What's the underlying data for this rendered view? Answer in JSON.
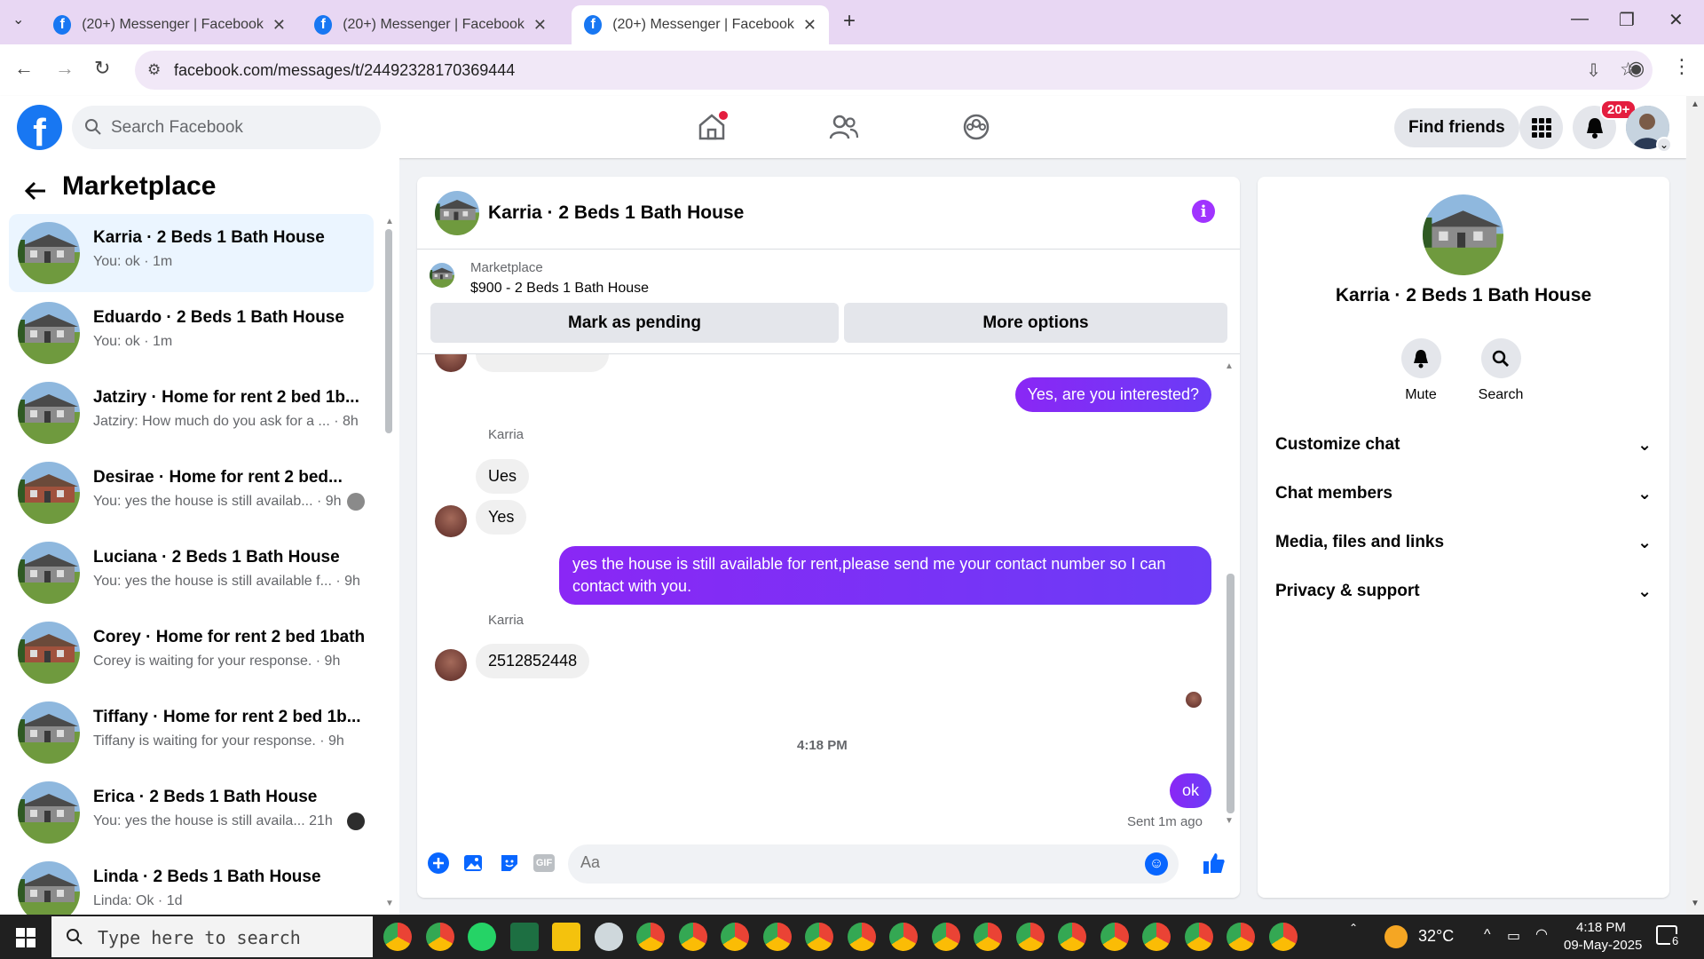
{
  "browser": {
    "tabs": [
      {
        "title": "(20+) Messenger | Facebook",
        "active": false
      },
      {
        "title": "(20+) Messenger | Facebook",
        "active": false
      },
      {
        "title": "(20+) Messenger | Facebook",
        "active": true
      }
    ],
    "url": "facebook.com/messages/t/24492328170369444"
  },
  "fb": {
    "search_placeholder": "Search Facebook",
    "find_friends": "Find friends",
    "notif_count": "20+"
  },
  "sidebar": {
    "title": "Marketplace",
    "conversations": [
      {
        "name": "Karria · 2 Beds 1 Bath House",
        "preview": "You: ok · 1m",
        "selected": true
      },
      {
        "name": "Eduardo · 2 Beds 1 Bath House",
        "preview": "You: ok · 1m"
      },
      {
        "name": "Jatziry · Home for rent 2 bed 1b...",
        "preview": "Jatziry: How much do you ask for a ... · 8h"
      },
      {
        "name": "Desirae · Home for rent 2 bed...",
        "preview": "You: yes the house is still availab... · 9h"
      },
      {
        "name": "Luciana · 2 Beds 1 Bath House",
        "preview": "You: yes the house is still available f... · 9h"
      },
      {
        "name": "Corey · Home for rent 2 bed 1bath",
        "preview": "Corey is waiting for your response. · 9h"
      },
      {
        "name": "Tiffany · Home for rent 2 bed 1b...",
        "preview": "Tiffany is waiting for your response. · 9h"
      },
      {
        "name": "Erica · 2 Beds 1 Bath House",
        "preview": "You: yes the house is still availa...   21h"
      },
      {
        "name": "Linda · 2 Beds 1 Bath House",
        "preview": "Linda: Ok · 1d"
      }
    ]
  },
  "chat": {
    "title": "Karria · 2 Beds 1 Bath House",
    "marketplace_label": "Marketplace",
    "listing": "$900 - 2 Beds 1 Bath House",
    "btn_pending": "Mark as pending",
    "btn_more": "More options",
    "messages": {
      "m1": "Yes, are you interested?",
      "sender1": "Karria",
      "m2": "Ues",
      "m3": "Yes",
      "m4a": "yes the house is still available for rent,please send me your contact number so I can",
      "m4b": "contact with you.",
      "sender2": "Karria",
      "m5": "2512852448",
      "time": "4:18 PM",
      "m6": "ok",
      "sent": "Sent 1m ago"
    },
    "input_placeholder": "Aa",
    "gif_label": "GIF"
  },
  "right_panel": {
    "name": "Karria · 2 Beds 1 Bath House",
    "mute": "Mute",
    "search": "Search",
    "sections": [
      "Customize chat",
      "Chat members",
      "Media, files and links",
      "Privacy & support"
    ]
  },
  "taskbar": {
    "search_placeholder": "Type here to search",
    "temperature": "32°C",
    "time": "4:18 PM",
    "date": "09-May-2025",
    "notif": "6"
  },
  "colors": {
    "fb_blue": "#1877f2",
    "my_bubble": "#7b2bf9",
    "selected_row": "#ebf5ff",
    "accent_purple": "#a033ff"
  }
}
